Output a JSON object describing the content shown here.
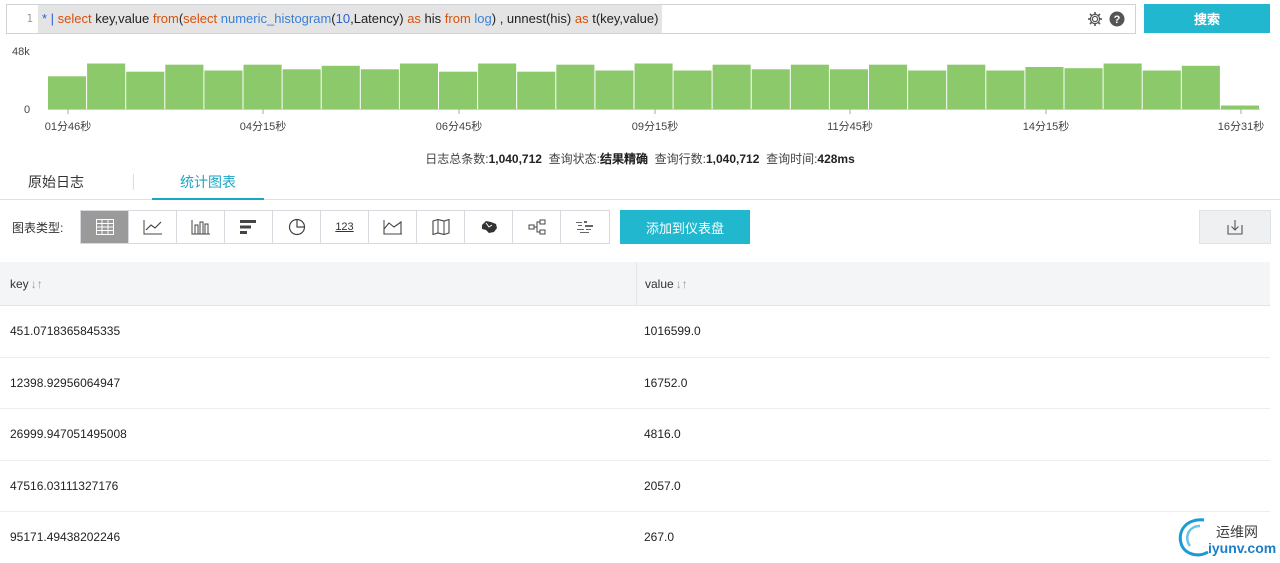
{
  "query": {
    "line_number": "1",
    "tokens": [
      {
        "text": "* ",
        "cls": "t-star"
      },
      {
        "text": "| ",
        "cls": "t-pipe"
      },
      {
        "text": "select ",
        "cls": "t-kw"
      },
      {
        "text": "key,value ",
        "cls": "t-id"
      },
      {
        "text": "from",
        "cls": "t-kw"
      },
      {
        "text": "(",
        "cls": "t-id"
      },
      {
        "text": "select ",
        "cls": "t-kw"
      },
      {
        "text": "numeric_histogram",
        "cls": "t-fn"
      },
      {
        "text": "(",
        "cls": "t-id"
      },
      {
        "text": "10",
        "cls": "t-num"
      },
      {
        "text": ",Latency) ",
        "cls": "t-id"
      },
      {
        "text": "as ",
        "cls": "t-kw"
      },
      {
        "text": "his ",
        "cls": "t-id"
      },
      {
        "text": "from ",
        "cls": "t-kw"
      },
      {
        "text": "log",
        "cls": "t-fn"
      },
      {
        "text": ") , unnest(his) ",
        "cls": "t-id"
      },
      {
        "text": "as ",
        "cls": "t-kw"
      },
      {
        "text": "t(key,value)",
        "cls": "t-id"
      }
    ],
    "settings_icon": "gear-icon",
    "help_icon": "help-icon",
    "search_button": "搜索"
  },
  "histogram": {
    "y_max_label": "48k",
    "y_min_label": "0",
    "bar_color": "#8cc96b",
    "y_max": 48000,
    "values": [
      28000,
      39000,
      32000,
      38000,
      33000,
      38000,
      34000,
      37000,
      34000,
      39000,
      32000,
      39000,
      32000,
      38000,
      33000,
      39000,
      33000,
      38000,
      34000,
      38000,
      34000,
      38000,
      33000,
      38000,
      33000,
      36000,
      35000,
      39000,
      33000,
      37000,
      3000
    ],
    "tick_labels": [
      "01分46秒",
      "04分15秒",
      "06分45秒",
      "09分15秒",
      "11分45秒",
      "14分15秒",
      "16分31秒"
    ]
  },
  "summary": {
    "total_label": "日志总条数:",
    "total_value": "1,040,712",
    "status_label": "查询状态:",
    "status_value": "结果精确",
    "rows_label": "查询行数:",
    "rows_value": "1,040,712",
    "time_label": "查询时间:",
    "time_value": "428ms"
  },
  "tabs": [
    {
      "label": "原始日志",
      "active": false
    },
    {
      "label": "统计图表",
      "active": true
    }
  ],
  "toolbar": {
    "chart_type_label": "图表类型:",
    "chart_types": [
      "table-icon",
      "line-chart-icon",
      "bar-chart-icon",
      "horizontal-bar-icon",
      "pie-chart-icon",
      "number-icon",
      "area-chart-icon",
      "map-icon",
      "china-map-icon",
      "flow-icon",
      "word-cloud-icon"
    ],
    "number_icon_text": "123",
    "add_to_dashboard": "添加到仪表盘",
    "download_icon": "download-icon"
  },
  "table": {
    "columns": [
      "key",
      "value"
    ],
    "sort_glyph": "↓↑",
    "rows": [
      [
        "451.0718365845335",
        "1016599.0"
      ],
      [
        "12398.92956064947",
        "16752.0"
      ],
      [
        "26999.947051495008",
        "4816.0"
      ],
      [
        "47516.03111327176",
        "2057.0"
      ],
      [
        "95171.49438202246",
        "267.0"
      ]
    ]
  },
  "watermark": {
    "cn": "运维网",
    "en": "iyunv.com"
  }
}
